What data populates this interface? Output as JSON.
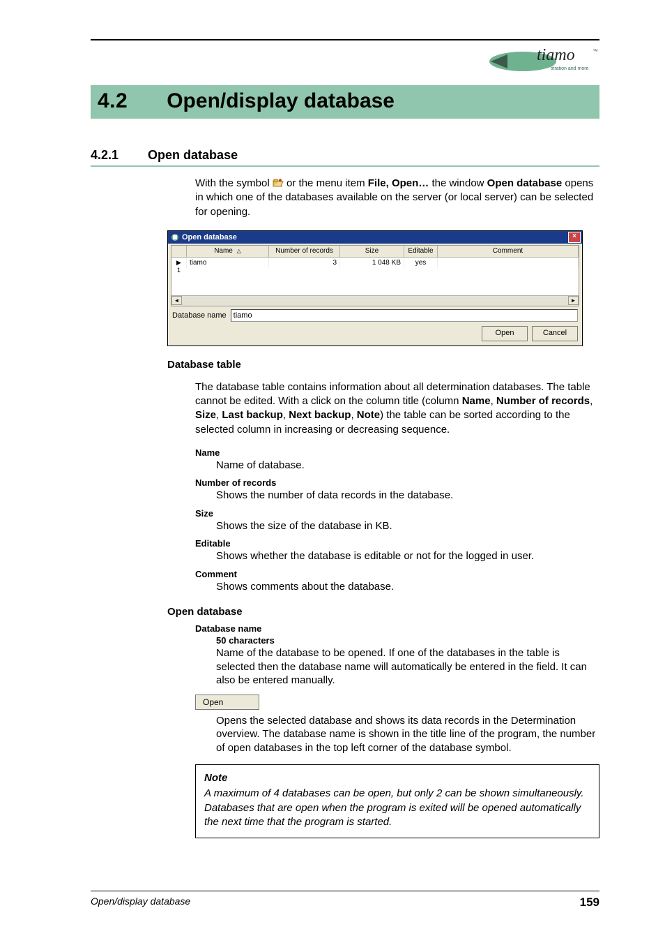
{
  "brand": {
    "name": "tiamo",
    "tagline": "titration and more",
    "tm": "™"
  },
  "heading1": {
    "number": "4.2",
    "title": "Open/display database"
  },
  "heading2": {
    "number": "4.2.1",
    "title": "Open database"
  },
  "intro": {
    "pre": "With the symbol ",
    "mid": " or the menu item ",
    "menu": "File, Open…",
    "mid2": " the window ",
    "win": "Open database",
    "post": " opens in which one of the databases available on the server (or local server) can be selected for opening."
  },
  "dialog": {
    "title": "Open database",
    "columns": {
      "name": "Name",
      "records": "Number of records",
      "size": "Size",
      "editable": "Editable",
      "comment": "Comment"
    },
    "sort_indicator": "△",
    "row1": {
      "marker_index": "1",
      "name": "tiamo",
      "records": "3",
      "size": "1 048 KB",
      "editable": "yes",
      "comment": ""
    },
    "db_name_label": "Database name",
    "db_name_value": "tiamo",
    "open_btn": "Open",
    "cancel_btn": "Cancel",
    "scroll_left": "◄",
    "scroll_right": "►",
    "close_glyph": "×"
  },
  "dbtable": {
    "heading": "Database table",
    "para_a": "The database table contains information about all determination databases. The table cannot be edited. With a click on the column title (column ",
    "cols": {
      "c1": "Name",
      "c2": "Number of records",
      "c3": "Size",
      "c4": "Last backup",
      "c5": "Next backup",
      "c6": "Note"
    },
    "para_b": ") the table can be sorted according to the selected column in increasing or decreasing sequence.",
    "defs": [
      {
        "term": "Name",
        "desc": "Name of database."
      },
      {
        "term": "Number of records",
        "desc": "Shows the number of data records in the database."
      },
      {
        "term": "Size",
        "desc": "Shows the size of the database in KB."
      },
      {
        "term": "Editable",
        "desc": "Shows whether the database is editable or not for the logged in user."
      },
      {
        "term": "Comment",
        "desc": "Shows comments about the database."
      }
    ]
  },
  "opendb": {
    "heading": "Open database",
    "dbname_term": "Database name",
    "dbname_constraint": "50 characters",
    "dbname_desc": "Name of the database to be opened. If one of the databases in the table is selected then the database name will automatically be entered in the field. It can also be entered manually.",
    "open_btn_label": "Open",
    "open_desc": "Opens the selected database and shows its data records in the Determination overview. The database name is shown in the title line of the program, the number of open databases in the top left corner of the database symbol."
  },
  "note": {
    "title": "Note",
    "body": "A maximum of 4 databases can be open, but only 2 can be shown simultaneously. Databases that are open when the program is exited will be opened automatically the next time that the program is started."
  },
  "footer": {
    "left": "Open/display database",
    "page": "159"
  }
}
